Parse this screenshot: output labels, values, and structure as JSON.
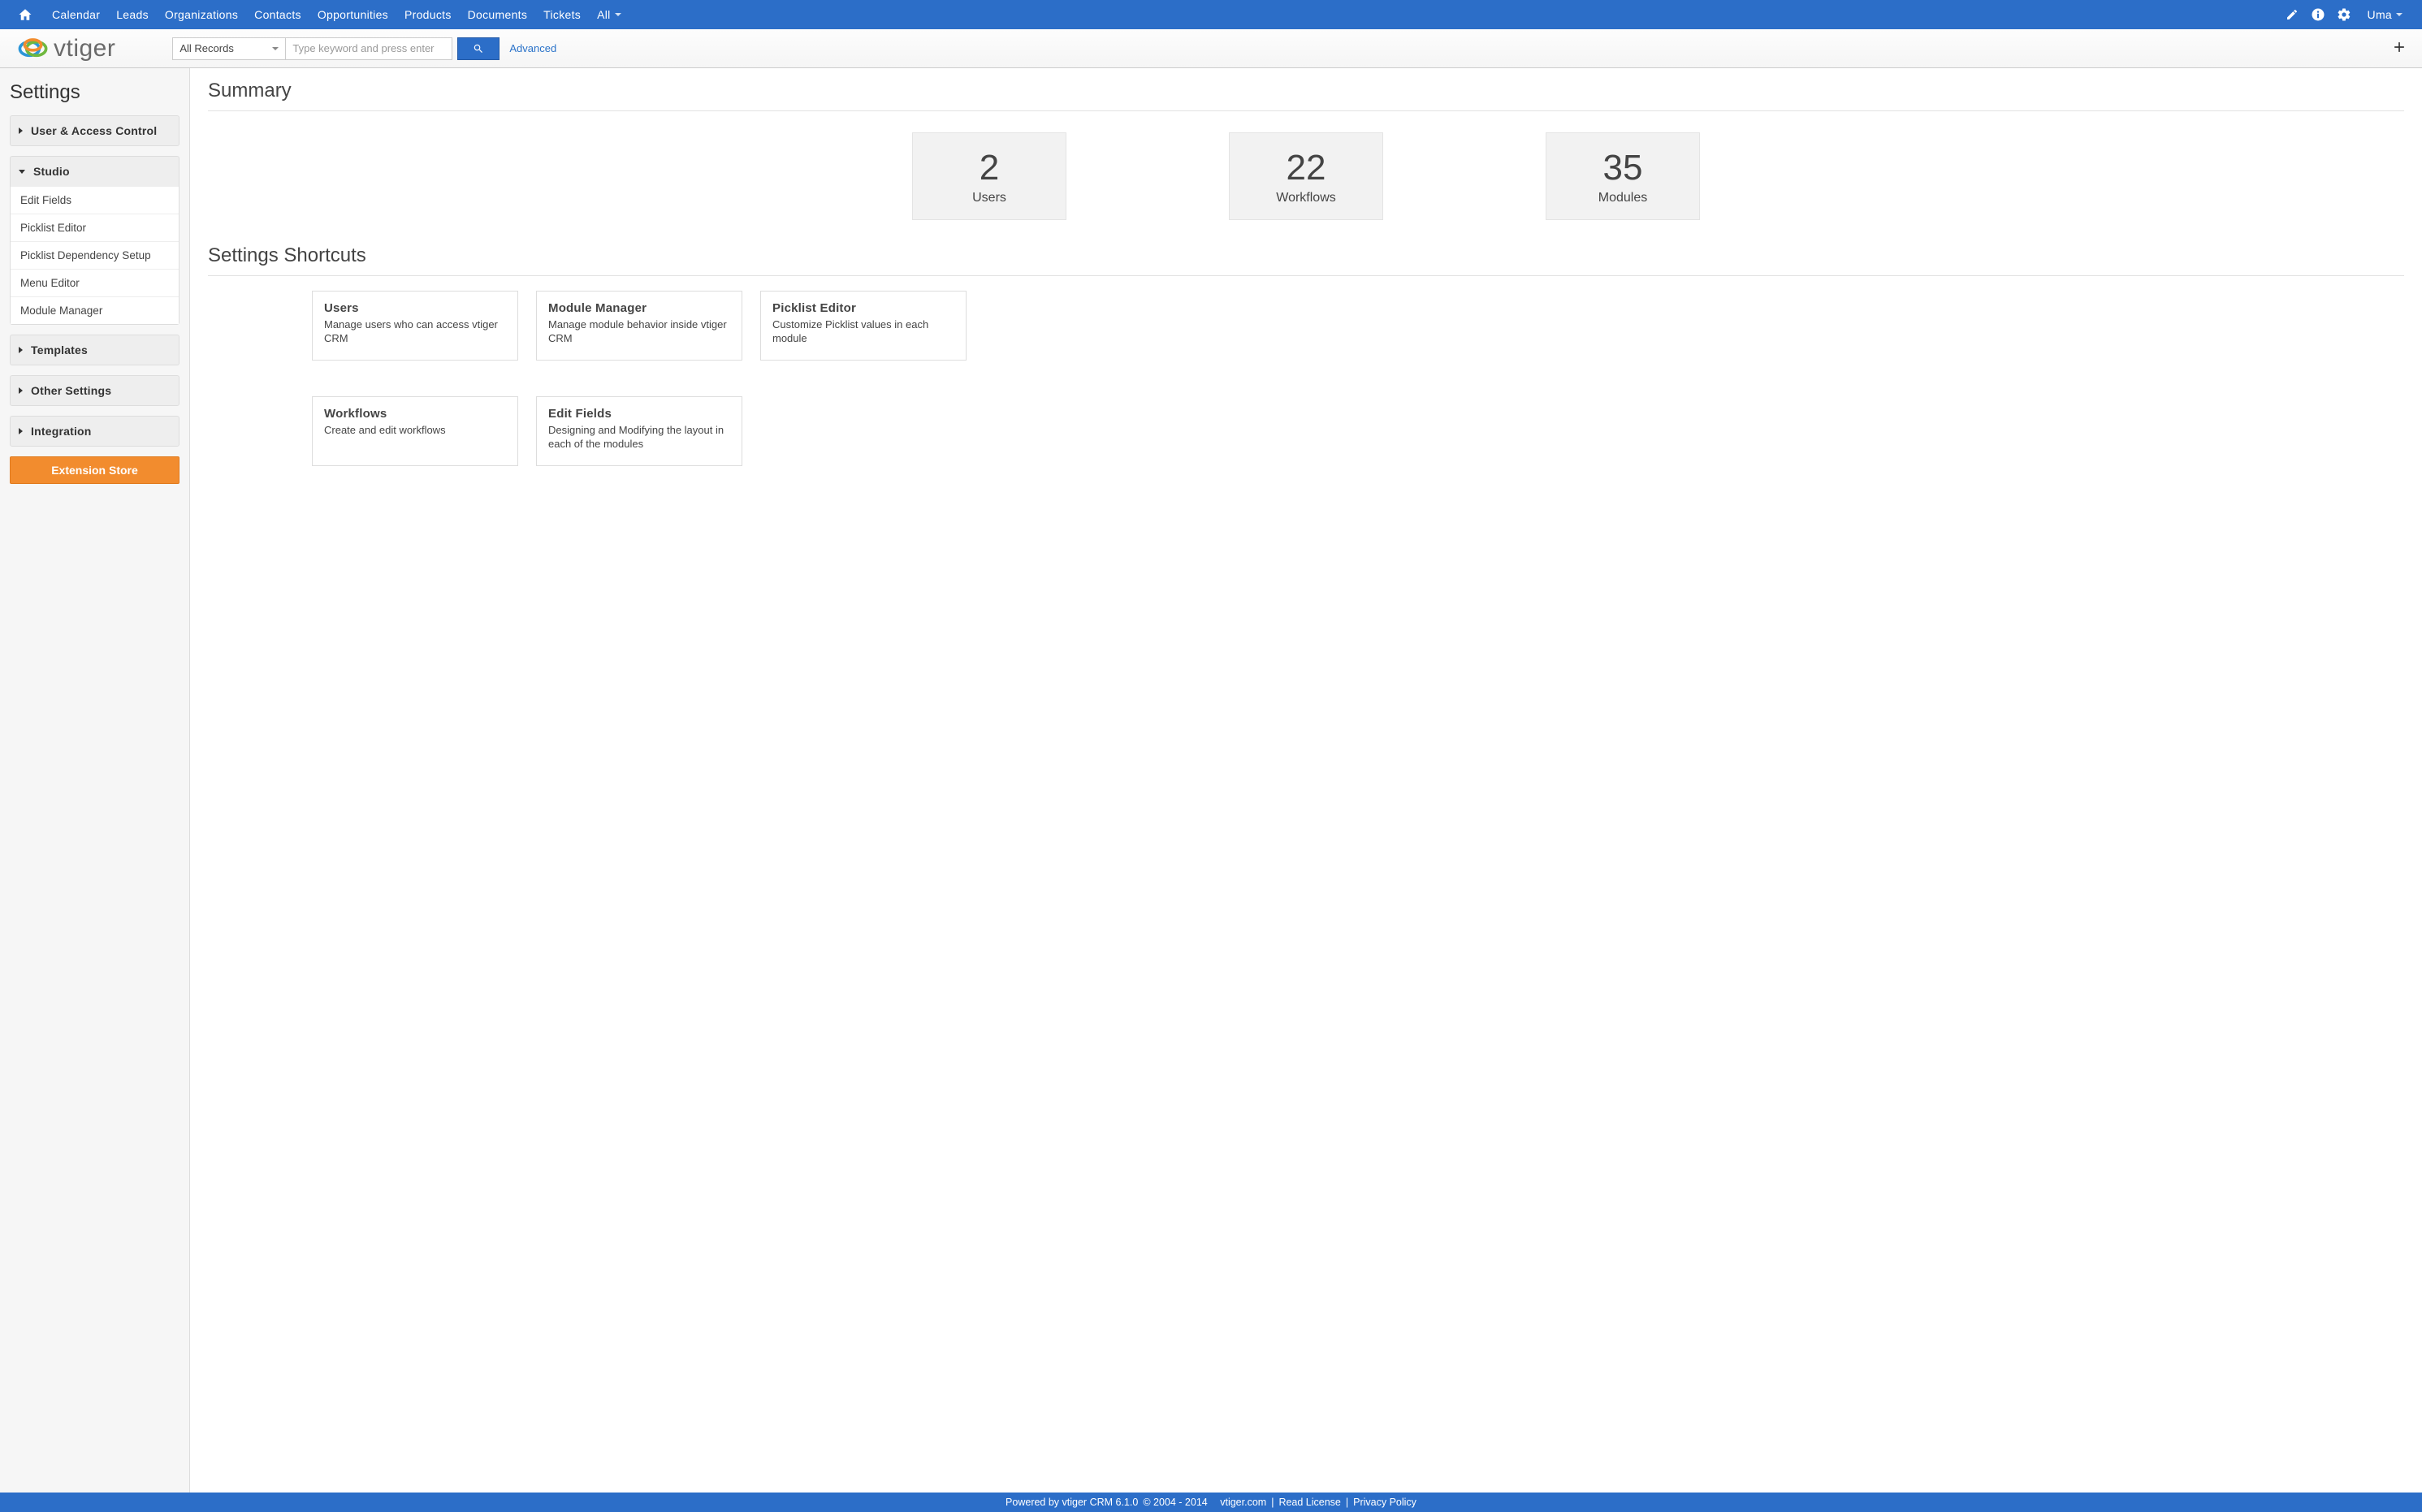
{
  "topnav": {
    "items": [
      "Calendar",
      "Leads",
      "Organizations",
      "Contacts",
      "Opportunities",
      "Products",
      "Documents",
      "Tickets",
      "All"
    ],
    "user": "Uma"
  },
  "search": {
    "select_value": "All Records",
    "placeholder": "Type keyword and press enter",
    "advanced_label": "Advanced"
  },
  "logo_text": "vtiger",
  "sidebar": {
    "title": "Settings",
    "groups": [
      {
        "title": "User & Access Control",
        "expanded": false,
        "items": []
      },
      {
        "title": "Studio",
        "expanded": true,
        "items": [
          "Edit Fields",
          "Picklist Editor",
          "Picklist Dependency Setup",
          "Menu Editor",
          "Module Manager"
        ]
      },
      {
        "title": "Templates",
        "expanded": false,
        "items": []
      },
      {
        "title": "Other Settings",
        "expanded": false,
        "items": []
      },
      {
        "title": "Integration",
        "expanded": false,
        "items": []
      }
    ],
    "extension_button": "Extension Store"
  },
  "content": {
    "summary_heading": "Summary",
    "stats": [
      {
        "number": "2",
        "label": "Users"
      },
      {
        "number": "22",
        "label": "Workflows"
      },
      {
        "number": "35",
        "label": "Modules"
      }
    ],
    "shortcuts_heading": "Settings Shortcuts",
    "shortcuts": [
      {
        "title": "Users",
        "desc": "Manage users who can access vtiger CRM"
      },
      {
        "title": "Module Manager",
        "desc": "Manage module behavior inside vtiger CRM"
      },
      {
        "title": "Picklist Editor",
        "desc": "Customize Picklist values in each module"
      },
      {
        "title": "Workflows",
        "desc": "Create and edit workflows"
      },
      {
        "title": "Edit Fields",
        "desc": "Designing and Modifying the layout in each of the modules"
      }
    ]
  },
  "footer": {
    "powered": "Powered by vtiger CRM 6.1.0",
    "copyright": "© 2004 - 2014",
    "site": "vtiger.com",
    "license": "Read License",
    "privacy": "Privacy Policy"
  }
}
